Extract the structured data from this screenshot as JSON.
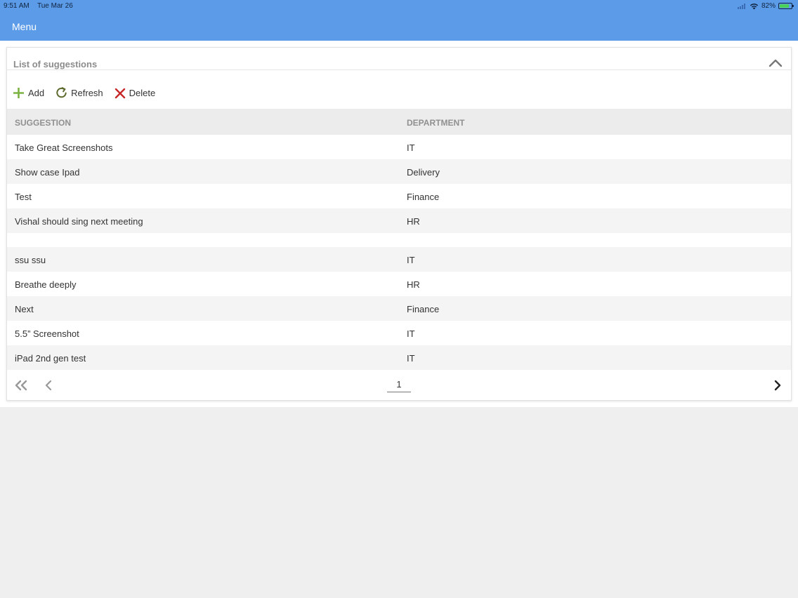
{
  "status": {
    "time": "9:51 AM",
    "date": "Tue Mar 26",
    "battery": "82%",
    "battery_level": 0.82,
    "icons": [
      "cellular-icon",
      "wifi-icon",
      "battery-charging-icon"
    ]
  },
  "nav": {
    "menu_label": "Menu"
  },
  "panel": {
    "title": "List of suggestions"
  },
  "toolbar": {
    "add_label": "Add",
    "refresh_label": "Refresh",
    "delete_label": "Delete"
  },
  "table": {
    "columns": [
      "SUGGESTION",
      "DEPARTMENT"
    ],
    "rows": [
      {
        "suggestion": "Take Great Screenshots",
        "department": "IT"
      },
      {
        "suggestion": "Show case Ipad",
        "department": "Delivery"
      },
      {
        "suggestion": "Test",
        "department": "Finance"
      },
      {
        "suggestion": "Vishal should sing next meeting",
        "department": "HR"
      },
      {
        "suggestion": "",
        "department": ""
      },
      {
        "suggestion": "ssu ssu",
        "department": "IT"
      },
      {
        "suggestion": "Breathe deeply",
        "department": "HR"
      },
      {
        "suggestion": "Next",
        "department": "Finance"
      },
      {
        "suggestion": "5.5” Screenshot",
        "department": "IT"
      },
      {
        "suggestion": "iPad 2nd gen test",
        "department": "IT"
      }
    ]
  },
  "pager": {
    "current_page": "1"
  },
  "colors": {
    "header_blue": "#5c9be8",
    "add_green": "#7cb342",
    "refresh_olive": "#5d6b2f",
    "delete_red": "#c62828"
  }
}
